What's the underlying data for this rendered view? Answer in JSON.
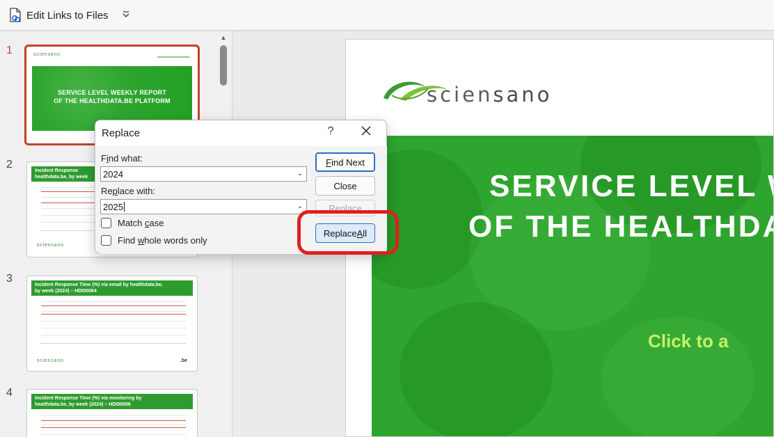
{
  "toolbar": {
    "edit_links_label": "Edit Links to Files",
    "more_icon": "chevron-down-icon"
  },
  "thumbnails": [
    {
      "number": "1",
      "title_line1": "SERVICE LEVEL WEEKLY REPORT",
      "title_line2": "OF THE HEALTHDATA.BE PLATFORM"
    },
    {
      "number": "2",
      "header_line1": "Incident   Response",
      "header_line2": "healthdata.be, by week"
    },
    {
      "number": "3",
      "header_line1": "Incident Response Time (%) via email by healthdata.be,",
      "header_line2": "by week (2024) – HDI00064",
      "be_label": ".be"
    },
    {
      "number": "4",
      "header_line1": "Incident   Response   Time   (%)   via   monitoring   by",
      "header_line2": "healthdata.be, by week (2024) – HDI00066"
    }
  ],
  "logo": {
    "part1": "scien",
    "part2": "sano"
  },
  "slide": {
    "title_line1": "SERVICE LEVEL W",
    "title_line2": "OF THE HEALTHDA",
    "click_hint": "Click to a"
  },
  "dialog": {
    "title": "Replace",
    "help": "?",
    "find_label_pre": "F",
    "find_label_u": "i",
    "find_label_post": "nd what:",
    "find_value": "2024",
    "replace_label_pre": "Re",
    "replace_label_u": "p",
    "replace_label_post": "lace with:",
    "replace_value": "2025",
    "match_case_pre": "Match ",
    "match_case_u": "c",
    "match_case_post": "ase",
    "whole_words_pre": "Find ",
    "whole_words_u": "w",
    "whole_words_post": "hole words only",
    "find_next_pre": "",
    "find_next_u": "F",
    "find_next_post": "ind Next",
    "close": "Close",
    "replace": "Replace",
    "replace_all_pre": "Replace ",
    "replace_all_u": "A",
    "replace_all_post": "ll"
  },
  "colors": {
    "accent_red": "#e01f1f",
    "slide_green": "#2ea52e",
    "selection": "#c0432a",
    "focus_blue": "#2b6fc2"
  }
}
